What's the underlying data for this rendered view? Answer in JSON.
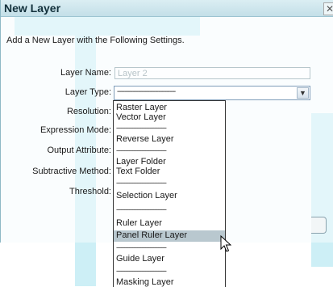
{
  "dialog": {
    "title": "New Layer",
    "close_glyph": "✕",
    "subtitle": "Add a New Layer with the Following Settings."
  },
  "fields": {
    "layer_name_label": "Layer Name:",
    "layer_name_placeholder": "Layer 2",
    "layer_type_label": "Layer Type:",
    "layer_type_value": "-------------------------------",
    "resolution_label": "Resolution:",
    "expression_mode_label": "Expression Mode:",
    "output_attribute_label": "Output Attribute:",
    "subtractive_method_label": "Subtractive Method:",
    "threshold_label": "Threshold:"
  },
  "dropdown": {
    "separator": "-------------------------------",
    "options": [
      "Raster Layer",
      "Vector Layer",
      "Reverse Layer",
      "Layer Folder",
      "Text Folder",
      "Selection Layer",
      "Ruler Layer",
      "Panel Ruler Layer",
      "Guide Layer",
      "Masking Layer"
    ],
    "highlighted_option": "Panel Ruler Layer"
  },
  "icons": {
    "close": "close-icon",
    "dropdown_arrow": "chevron-down-icon",
    "cursor": "mouse-pointer-icon"
  },
  "colors": {
    "title_bar": "#c3dfe8",
    "watermark": "#cdeff6",
    "highlight": "#b9c8cf"
  }
}
